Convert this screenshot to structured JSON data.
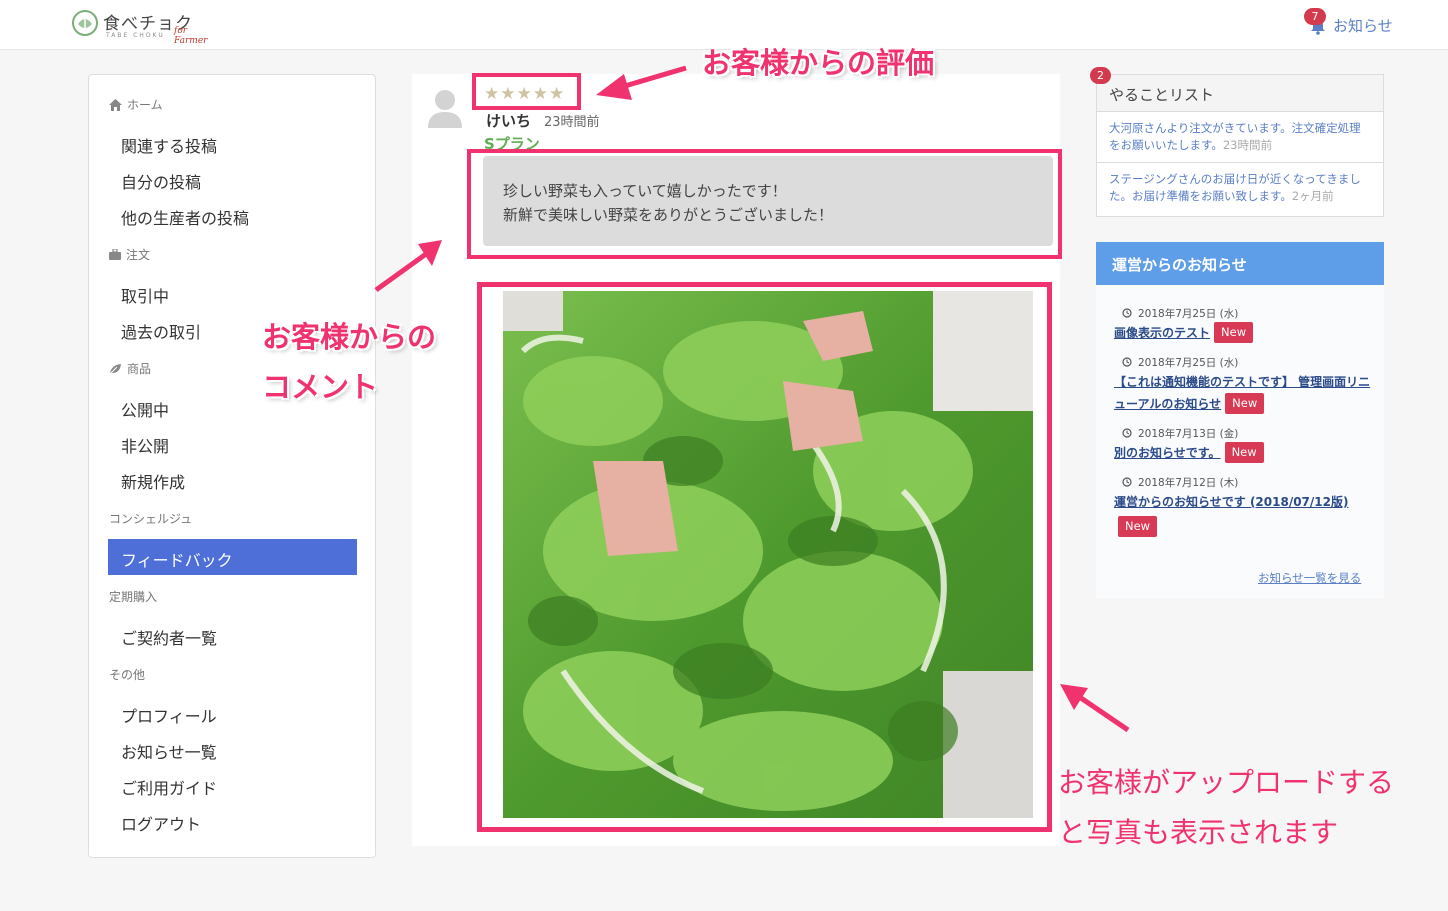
{
  "header": {
    "logo_text": "食べチョク",
    "logo_sub": "TABE CHOKU",
    "logo_for": "for Farmer",
    "notice_label": "お知らせ",
    "notice_count": "7"
  },
  "sidebar": {
    "sections": [
      {
        "label": "ホーム",
        "icon": "home-icon",
        "items": [
          "関連する投稿",
          "自分の投稿",
          "他の生産者の投稿"
        ]
      },
      {
        "label": "注文",
        "icon": "briefcase-icon",
        "items": [
          "取引中",
          "過去の取引"
        ]
      },
      {
        "label": "商品",
        "icon": "leaf-icon",
        "items": [
          "公開中",
          "非公開",
          "新規作成"
        ]
      },
      {
        "label": "コンシェルジュ",
        "icon": "",
        "items": [
          "フィードバック"
        ]
      },
      {
        "label": "定期購入",
        "icon": "",
        "items": [
          "ご契約者一覧"
        ]
      },
      {
        "label": "その他",
        "icon": "",
        "items": [
          "プロフィール",
          "お知らせ一覧",
          "ご利用ガイド",
          "ログアウト"
        ]
      }
    ],
    "active_item": "フィードバック"
  },
  "feedback": {
    "stars": "★★★★★",
    "rating": 5,
    "user_name": "けいち",
    "time_ago": "23時間前",
    "plan": "Sプラン",
    "comment_line1": "珍しい野菜も入っていて嬉しかったです！",
    "comment_line2": "新鮮で美味しい野菜をありがとうございました！"
  },
  "todo": {
    "title": "やることリスト",
    "count": "2",
    "items": [
      {
        "text": "大河原さんより注文がきています。注文確定処理をお願いいたします。",
        "ago": "23時間前"
      },
      {
        "text": "ステージングさんのお届け日が近くなってきました。お届け準備をお願い致します。",
        "ago": "2ヶ月前"
      }
    ]
  },
  "news": {
    "title": "運営からのお知らせ",
    "new_label": "New",
    "items": [
      {
        "date": "2018年7月25日 (水)",
        "title": "画像表示のテスト"
      },
      {
        "date": "2018年7月25日 (水)",
        "title": "【これは通知機能のテストです】 管理画面リニューアルのお知らせ"
      },
      {
        "date": "2018年7月13日 (金)",
        "title": "別のお知らせです。"
      },
      {
        "date": "2018年7月12日 (木)",
        "title": "運営からのお知らせです (2018/07/12版)"
      }
    ],
    "view_all": "お知らせ一覧を見る"
  },
  "annotations": {
    "rating": "お客様からの評価",
    "comment_line1": "お客様からの",
    "comment_line2": "コメント",
    "photo_line1": "お客様がアップロードする",
    "photo_line2": "と写真も表示されます"
  },
  "colors": {
    "accent_pink": "#f0336e",
    "sidebar_active": "#4f6fd8",
    "news_header": "#5e9de8",
    "plan_green": "#5fae52",
    "badge_red": "#d33a4e"
  }
}
